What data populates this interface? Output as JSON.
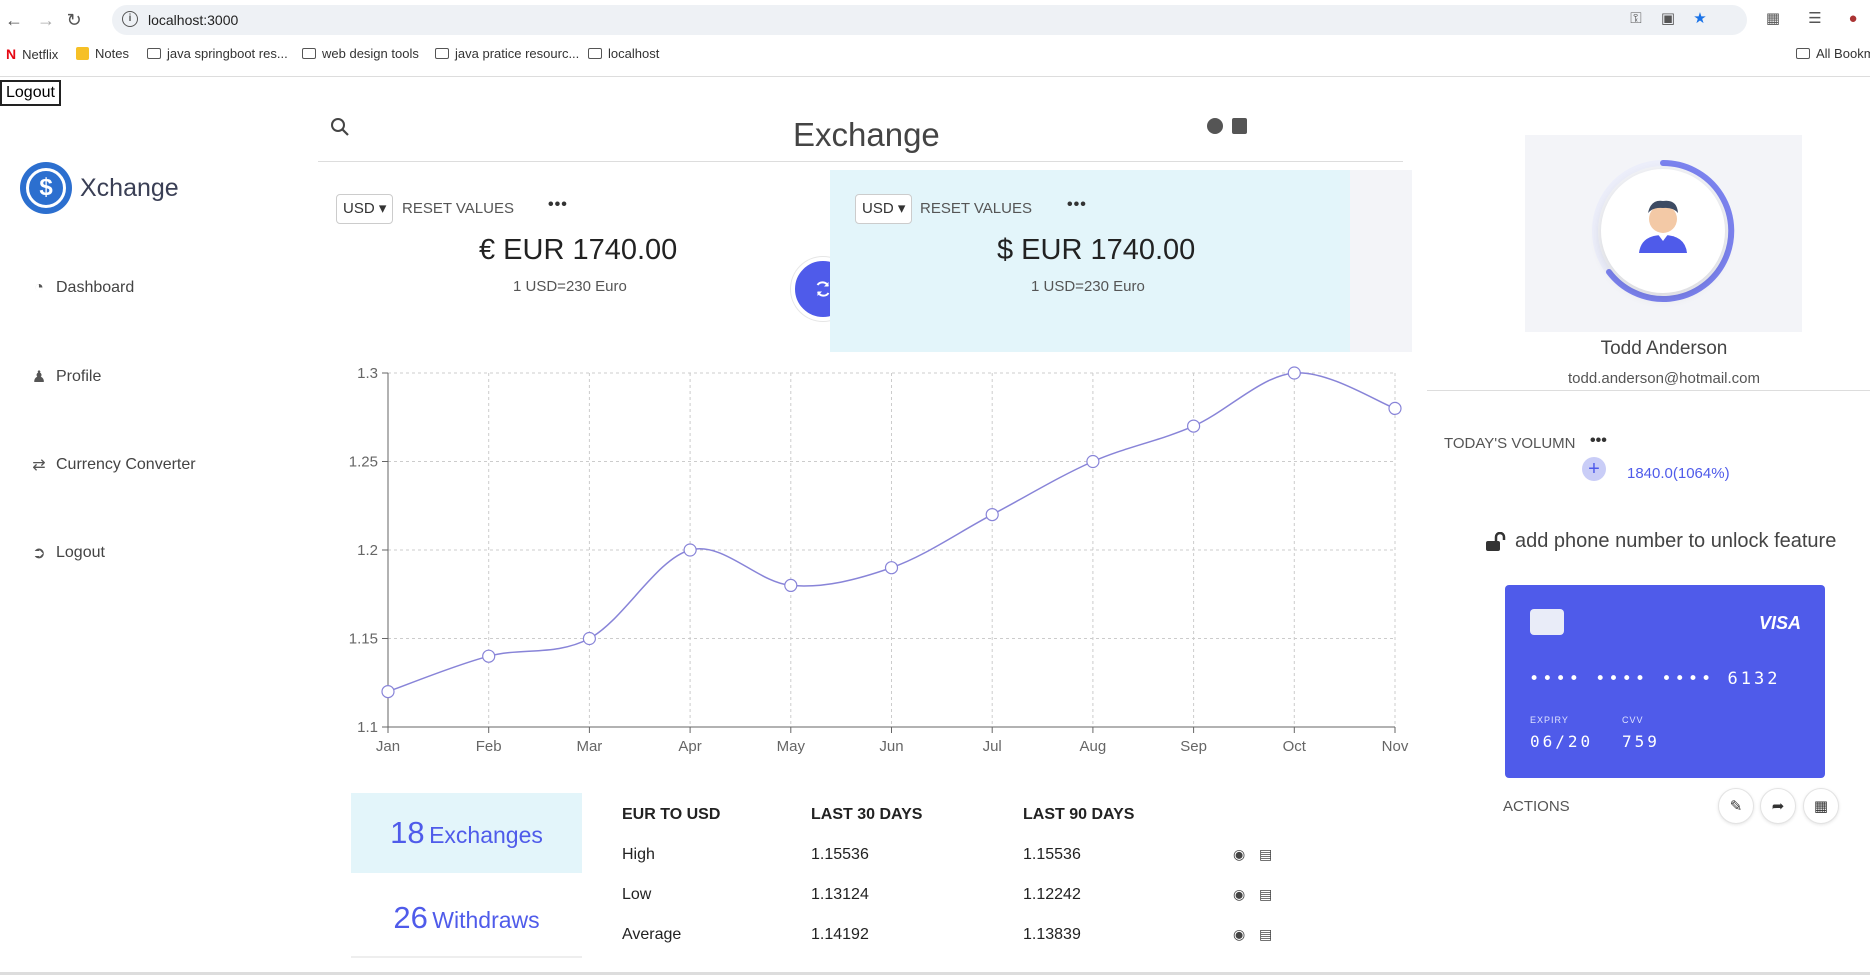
{
  "browser": {
    "url": "localhost:3000",
    "bookmarks": [
      "Netflix",
      "Notes",
      "java springboot res...",
      "web design tools",
      "java pratice resourc...",
      "localhost",
      "All Bookm"
    ]
  },
  "top_logout": "Logout",
  "sidebar": {
    "brand": "Xchange",
    "items": [
      {
        "label": "Dashboard",
        "icon": "dashboard-icon"
      },
      {
        "label": "Profile",
        "icon": "profile-icon"
      },
      {
        "label": "Currency Converter",
        "icon": "exchange-arrows-icon"
      },
      {
        "label": "Logout",
        "icon": "logout-icon"
      }
    ]
  },
  "header": {
    "title": "Exchange"
  },
  "converter": {
    "left": {
      "currency": "USD",
      "reset": "RESET VALUES",
      "amount": "€ EUR 1740.00",
      "rate": "1 USD=230 Euro"
    },
    "right": {
      "currency": "USD",
      "reset": "RESET VALUES",
      "amount": "$ EUR 1740.00",
      "rate": "1 USD=230 Euro"
    }
  },
  "chart_data": {
    "type": "line",
    "categories": [
      "Jan",
      "Feb",
      "Mar",
      "Apr",
      "May",
      "Jun",
      "Jul",
      "Aug",
      "Sep",
      "Oct",
      "Nov"
    ],
    "values": [
      1.12,
      1.14,
      1.15,
      1.2,
      1.18,
      1.19,
      1.22,
      1.25,
      1.27,
      1.3,
      1.28
    ],
    "yticks": [
      "1.1",
      "1.15",
      "1.2",
      "1.25",
      "1.3"
    ],
    "ylim": [
      1.1,
      1.3
    ],
    "grid": true,
    "color": "#8884d8"
  },
  "stats": {
    "exchanges": {
      "count": "18",
      "label": "Exchanges"
    },
    "withdraws": {
      "count": "26",
      "label": "Withdraws"
    }
  },
  "rates_table": {
    "headers": [
      "EUR TO USD",
      "LAST 30 DAYS",
      "LAST 90 DAYS"
    ],
    "rows": [
      {
        "label": "High",
        "d30": "1.15536",
        "d90": "1.15536"
      },
      {
        "label": "Low",
        "d30": "1.13124",
        "d90": "1.12242"
      },
      {
        "label": "Average",
        "d30": "1.14192",
        "d90": "1.13839"
      }
    ]
  },
  "profile": {
    "name": "Todd Anderson",
    "email": "todd.anderson@hotmail.com",
    "volume_label": "TODAY'S VOLUMN",
    "volume_value": "1840.0(1064%)",
    "unlock_text": "add phone number to unlock feature"
  },
  "card": {
    "brand": "VISA",
    "number": "•••• •••• •••• 6132",
    "expiry_label": "EXPIRY",
    "expiry": "06/20",
    "cvv_label": "CVV",
    "cvv": "759"
  },
  "actions_label": "ACTIONS",
  "colors": {
    "accent": "#4f5bea",
    "card_bg": "#e3f5fa"
  }
}
